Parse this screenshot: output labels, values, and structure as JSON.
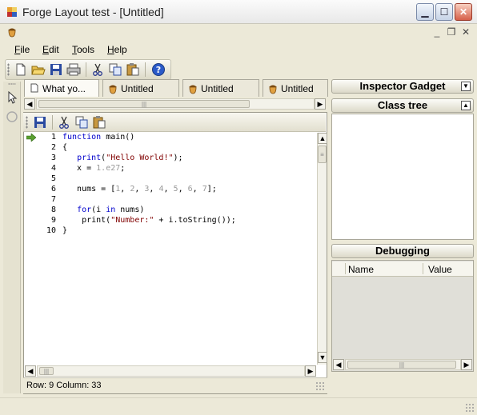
{
  "window": {
    "title": "Forge Layout test - [Untitled]",
    "controls": {
      "minimize": "▁",
      "maximize": "☐",
      "close": "✕"
    },
    "mdi_controls": {
      "minimize": "_",
      "restore": "❐",
      "close": "✕"
    }
  },
  "menu": [
    {
      "accel": "F",
      "rest": "ile"
    },
    {
      "accel": "E",
      "rest": "dit"
    },
    {
      "accel": "T",
      "rest": "ools"
    },
    {
      "accel": "H",
      "rest": "elp"
    }
  ],
  "toolbar_icons": [
    "new-file-icon",
    "open-folder-icon",
    "save-icon",
    "print-icon",
    "cut-icon",
    "copy-icon",
    "paste-icon",
    "help-icon"
  ],
  "tabs": [
    {
      "label": "What yo..."
    },
    {
      "label": "Untitled"
    },
    {
      "label": "Untitled"
    },
    {
      "label": "Untitled"
    }
  ],
  "editor": {
    "lines": [
      {
        "n": "1",
        "parts": [
          [
            "kw",
            "function"
          ],
          [
            "",
            " main()"
          ]
        ]
      },
      {
        "n": "2",
        "parts": [
          [
            "",
            "{"
          ]
        ]
      },
      {
        "n": "3",
        "parts": [
          [
            "",
            "   "
          ],
          [
            "kw",
            "print"
          ],
          [
            "",
            "("
          ],
          [
            "str",
            "\"Hello World!\""
          ],
          [
            "",
            ");"
          ]
        ]
      },
      {
        "n": "4",
        "parts": [
          [
            "",
            "   x = "
          ],
          [
            "num",
            "1.e27"
          ],
          [
            "",
            ";"
          ]
        ]
      },
      {
        "n": "5",
        "parts": [
          [
            "",
            ""
          ]
        ]
      },
      {
        "n": "6",
        "parts": [
          [
            "",
            "   nums = ["
          ],
          [
            "num",
            "1"
          ],
          [
            "",
            ", "
          ],
          [
            "num",
            "2"
          ],
          [
            "",
            ", "
          ],
          [
            "num",
            "3"
          ],
          [
            "",
            ", "
          ],
          [
            "num",
            "4"
          ],
          [
            "",
            ", "
          ],
          [
            "num",
            "5"
          ],
          [
            "",
            ", "
          ],
          [
            "num",
            "6"
          ],
          [
            "",
            ", "
          ],
          [
            "num",
            "7"
          ],
          [
            "",
            "];"
          ]
        ]
      },
      {
        "n": "7",
        "parts": [
          [
            "",
            ""
          ]
        ]
      },
      {
        "n": "8",
        "parts": [
          [
            "",
            "   "
          ],
          [
            "kw",
            "for"
          ],
          [
            "",
            "(i "
          ],
          [
            "kw",
            "in"
          ],
          [
            "",
            " nums)"
          ]
        ]
      },
      {
        "n": "9",
        "parts": [
          [
            "",
            "    print("
          ],
          [
            "str",
            "\"Number:\""
          ],
          [
            "",
            " + i.toString());"
          ]
        ]
      },
      {
        "n": "10",
        "parts": [
          [
            "",
            "}"
          ]
        ]
      }
    ],
    "status": "Row: 9  Column: 33"
  },
  "panels": {
    "inspector_title": "Inspector Gadget",
    "classtree_title": "Class tree",
    "debugging_title": "Debugging",
    "col_name": "Name",
    "col_value": "Value"
  },
  "colors": {
    "keyword": "#0000cc",
    "string": "#800000",
    "number": "#999999"
  }
}
